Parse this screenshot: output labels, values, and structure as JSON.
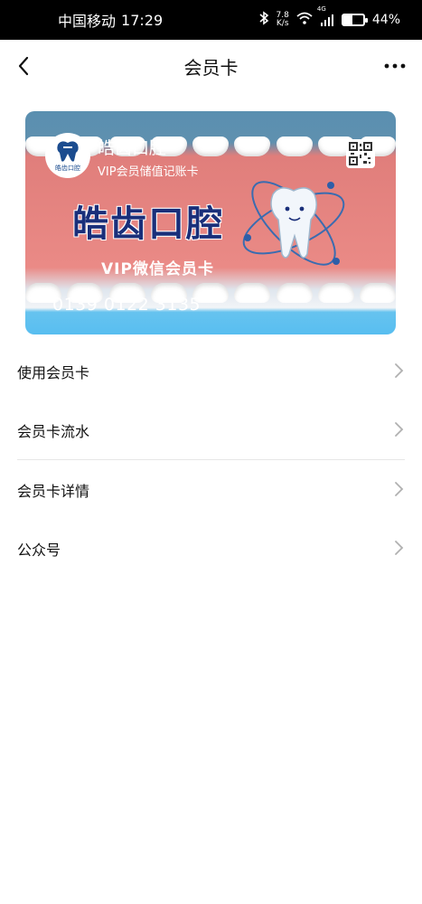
{
  "status_bar": {
    "carrier": "中国移动",
    "time": "17:29",
    "net_speed_value": "7.8",
    "net_speed_unit": "K/s",
    "signal_tag": "4G",
    "battery": "44%",
    "battery_level": 0.44
  },
  "header": {
    "title": "会员卡"
  },
  "card": {
    "logo_text": "皓齿口腔",
    "name": "皓齿口腔",
    "subtitle": "VIP会员储值记账卡",
    "brand_title": "皓齿口腔",
    "vip_text": "VIP微信会员卡",
    "number": "0139 0122 3135"
  },
  "menu": {
    "items": [
      {
        "label": "使用会员卡"
      },
      {
        "label": "会员卡流水"
      },
      {
        "label": "会员卡详情"
      },
      {
        "label": "公众号"
      }
    ]
  },
  "colors": {
    "card_navy": "#1a2f7a",
    "chevron": "#b0b0b0"
  }
}
